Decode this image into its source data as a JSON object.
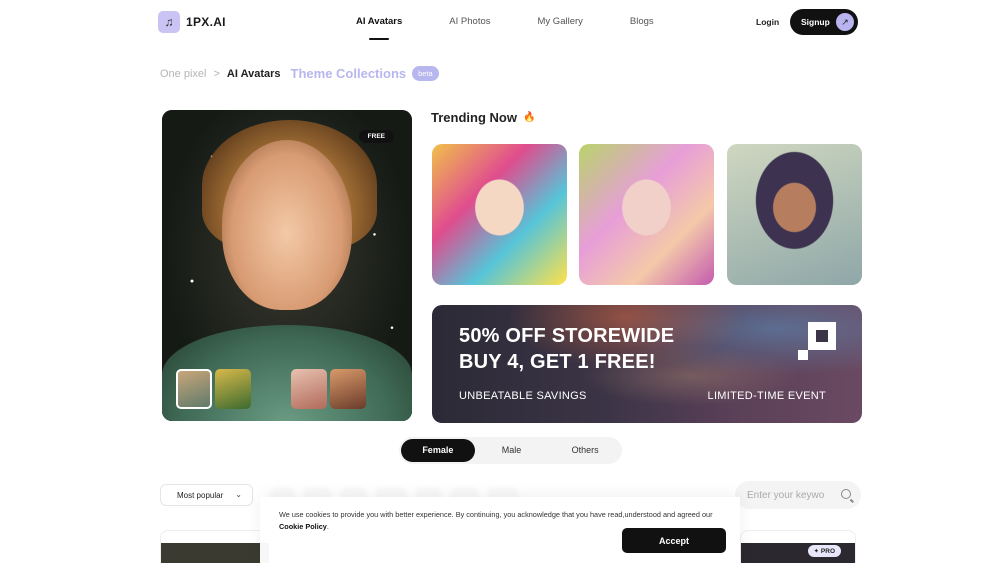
{
  "header": {
    "logo_text": "1PX.AI",
    "logo_glyph": "♫",
    "nav": [
      {
        "label": "AI Avatars",
        "active": true
      },
      {
        "label": "AI Photos",
        "active": false
      },
      {
        "label": "My Gallery",
        "active": false
      },
      {
        "label": "Blogs",
        "active": false
      }
    ],
    "login_label": "Login",
    "signup_label": "Signup",
    "signup_arrow": "↗"
  },
  "breadcrumb": {
    "root": "One pixel",
    "separator": ">",
    "current": "AI Avatars",
    "section": "Theme Collections",
    "badge": "beta"
  },
  "hero": {
    "badge": "FREE",
    "thumbnails": [
      "avatar-1",
      "avatar-2",
      "avatar-3",
      "avatar-4"
    ],
    "selected_index": 0
  },
  "trending": {
    "title": "Trending Now",
    "icon": "fire-icon",
    "cards": [
      "trending-1",
      "trending-2",
      "trending-3"
    ]
  },
  "promo": {
    "line1": "50% OFF STOREWIDE",
    "line2": "BUY 4, GET 1 FREE!",
    "sub_left": "UNBEATABLE SAVINGS",
    "sub_right": "LIMITED-TIME EVENT"
  },
  "gender_tabs": [
    {
      "label": "Female",
      "active": true
    },
    {
      "label": "Male",
      "active": false
    },
    {
      "label": "Others",
      "active": false
    }
  ],
  "filters": {
    "sort_label": "Most popular",
    "search_placeholder": "Enter your keywo"
  },
  "grid": {
    "pro_badge": "✦ PRO"
  },
  "cookie": {
    "text": "We use cookies to provide you with better experience. By continuing, you acknowledge that you have read,understood and agreed our",
    "policy_link": "Cookie Policy",
    "period": ".",
    "accept_label": "Accept"
  },
  "colors": {
    "accent": "#b8b6ee",
    "primary": "#111111"
  }
}
